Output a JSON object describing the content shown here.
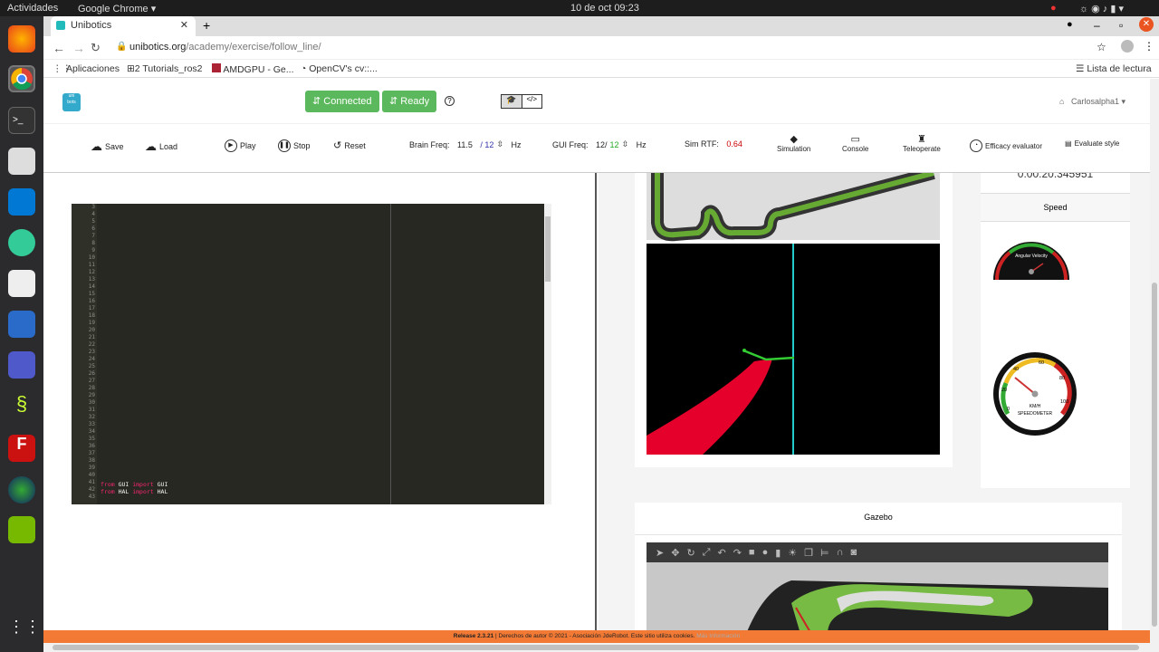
{
  "system": {
    "activities": "Actividades",
    "app_menu": "Google Chrome",
    "datetime": "10 de oct  09:23"
  },
  "browser": {
    "tab_title": "Unibotics",
    "url_host": "unibotics.org",
    "url_path": "/academy/exercise/follow_line/",
    "bookmarks": [
      "Aplicaciones",
      "Tutorials_ros2",
      "AMDGPU - Ge...",
      "OpenCV's cv::..."
    ],
    "reading_list": "Lista de lectura"
  },
  "navbar": {
    "logo": "uni\nbots",
    "connected": "Connected",
    "ready": "Ready",
    "help": "?",
    "user": "Carlosalpha1"
  },
  "toolbar": {
    "save": "Save",
    "load": "Load",
    "play": "Play",
    "stop": "Stop",
    "reset": "Reset",
    "brain_freq_label": "Brain Freq:",
    "brain_freq_value": "11.5",
    "brain_freq_target": "/  12",
    "hz1": "Hz",
    "gui_freq_label": "GUI Freq:",
    "gui_freq_value": "12/",
    "gui_freq_target": "12",
    "hz2": "Hz",
    "sim_rtf_label": "Sim RTF:",
    "sim_rtf_value": "0.64",
    "simulation": "Simulation",
    "console": "Console",
    "teleoperate": "Teleoperate",
    "efficacy": "Efficacy evaluator",
    "evaluate_style": "Evaluate style"
  },
  "editor": {
    "line_numbers": [
      "3",
      "4",
      "5",
      "6",
      "7",
      "8",
      "9",
      "10",
      "11",
      "12",
      "13",
      "14",
      "15",
      "16",
      "17",
      "18",
      "19",
      "20",
      "21",
      "22",
      "23",
      "24",
      "25",
      "26",
      "27",
      "28",
      "29",
      "30",
      "31",
      "32",
      "33",
      "34",
      "35",
      "36",
      "37",
      "38",
      "39",
      "40",
      "41",
      "42",
      "43"
    ],
    "code_lines": [
      {
        "kw1": "from",
        "mod": " GUI ",
        "kw2": "import",
        "name": " GUI"
      },
      {
        "kw1": "from",
        "mod": " HAL ",
        "kw2": "import",
        "name": " HAL"
      }
    ]
  },
  "panel": {
    "timer": "0:00:20.345951",
    "speed_title": "Speed",
    "angular_label": "Angular Velocity",
    "speedometer_ticks": [
      "0",
      "20",
      "40",
      "60",
      "80",
      "100"
    ],
    "kmh": "KM/H",
    "speedometer_label": "SPEEDOMETER",
    "gazebo_title": "Gazebo"
  },
  "footer": {
    "release": "Release 2.3.21",
    "rights": " | Derechos de autor © 2021 - Asociación JdeRobot. Este sitio utiliza cookies. ",
    "more": "Más Información"
  },
  "colors": {
    "green": "#5cb85c",
    "accent": "#f27a35",
    "editor_bg": "#272822",
    "track_red": "#e4002b"
  }
}
